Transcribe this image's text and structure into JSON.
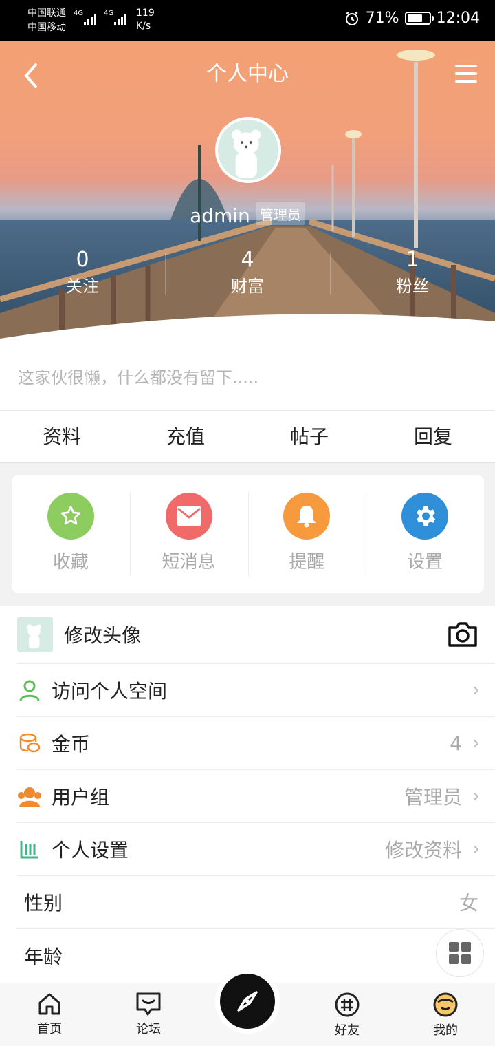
{
  "status_bar": {
    "carrier1": "中国联通",
    "carrier2": "中国移动",
    "net1": "4G",
    "net2": "4G",
    "speed_value": "119",
    "speed_unit": "K/s",
    "battery": "71%",
    "time": "12:04"
  },
  "header": {
    "title": "个人中心"
  },
  "profile": {
    "username": "admin",
    "role": "管理员",
    "stats": [
      {
        "value": "0",
        "label": "关注"
      },
      {
        "value": "4",
        "label": "财富"
      },
      {
        "value": "1",
        "label": "粉丝"
      }
    ],
    "bio": "这家伙很懒，什么都没有留下....."
  },
  "tabs": [
    "资料",
    "充值",
    "帖子",
    "回复"
  ],
  "quick_actions": [
    {
      "label": "收藏",
      "icon": "star-icon",
      "color": "#8dcc5e"
    },
    {
      "label": "短消息",
      "icon": "mail-icon",
      "color": "#f06a6a"
    },
    {
      "label": "提醒",
      "icon": "bell-icon",
      "color": "#f79a3e"
    },
    {
      "label": "设置",
      "icon": "gear-icon",
      "color": "#2f8fd8"
    }
  ],
  "list": {
    "change_avatar": "修改头像",
    "visit_space": "访问个人空间",
    "coins": {
      "label": "金币",
      "value": "4"
    },
    "user_group": {
      "label": "用户组",
      "value": "管理员"
    },
    "personal_settings": {
      "label": "个人设置",
      "value": "修改资料"
    },
    "gender": {
      "label": "性别",
      "value": "女"
    },
    "age": {
      "label": "年龄"
    }
  },
  "chevron": "›",
  "tabbar": [
    {
      "label": "首页",
      "icon": "home-icon"
    },
    {
      "label": "论坛",
      "icon": "forum-icon"
    },
    {
      "label": "",
      "icon": "compass-icon"
    },
    {
      "label": "好友",
      "icon": "hash-icon"
    },
    {
      "label": "我的",
      "icon": "face-icon"
    }
  ]
}
